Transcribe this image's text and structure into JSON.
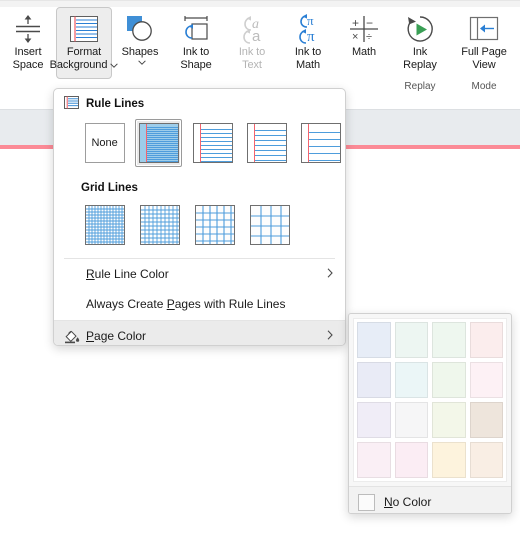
{
  "ribbon": {
    "groups": [
      {
        "label": "",
        "buttons": [
          {
            "name": "insert-space",
            "icon": "insert-space-icon",
            "line1": "Insert",
            "line2": "Space",
            "dim": false,
            "chevron": false,
            "active": false
          }
        ]
      },
      {
        "label": "",
        "buttons": [
          {
            "name": "format-background",
            "icon": "ruled-page-icon",
            "line1": "Format",
            "line2": "Background",
            "dim": false,
            "chevron": true,
            "active": true
          }
        ]
      },
      {
        "label": "",
        "buttons": [
          {
            "name": "shapes",
            "icon": "shapes-icon",
            "line1": "Shapes",
            "line2": "",
            "dim": false,
            "chevron": true,
            "active": false
          }
        ]
      },
      {
        "label": "",
        "buttons": [
          {
            "name": "ink-to-shape",
            "icon": "ink-to-shape-icon",
            "line1": "Ink to",
            "line2": "Shape",
            "dim": false,
            "chevron": false,
            "active": false
          },
          {
            "name": "ink-to-text",
            "icon": "ink-to-text-icon",
            "line1": "Ink to",
            "line2": "Text",
            "dim": true,
            "chevron": false,
            "active": false
          },
          {
            "name": "ink-to-math",
            "icon": "ink-to-math-icon",
            "line1": "Ink to",
            "line2": "Math",
            "dim": false,
            "chevron": false,
            "active": false
          },
          {
            "name": "math",
            "icon": "math-icon",
            "line1": "Math",
            "line2": "",
            "dim": false,
            "chevron": false,
            "active": false
          }
        ]
      },
      {
        "label": "Replay",
        "buttons": [
          {
            "name": "ink-replay",
            "icon": "ink-replay-icon",
            "line1": "Ink",
            "line2": "Replay",
            "dim": false,
            "chevron": false,
            "active": false
          }
        ]
      },
      {
        "label": "Mode",
        "buttons": [
          {
            "name": "full-page-view",
            "icon": "full-page-view-icon",
            "line1": "Full Page",
            "line2": "View",
            "dim": false,
            "chevron": false,
            "active": false
          }
        ]
      }
    ]
  },
  "menu": {
    "rule_lines": {
      "icon": "ruled-page-icon",
      "title": "Rule Lines",
      "thumbs": [
        {
          "name": "rule-lines-none",
          "label": "None",
          "kind": "none",
          "spacing": 0,
          "selected": false
        },
        {
          "name": "rule-lines-narrow",
          "label": "",
          "kind": "ruled",
          "spacing": 2,
          "selected": true
        },
        {
          "name": "rule-lines-college",
          "label": "",
          "kind": "ruled",
          "spacing": 4,
          "selected": false
        },
        {
          "name": "rule-lines-wide",
          "label": "",
          "kind": "ruled",
          "spacing": 5,
          "selected": false
        },
        {
          "name": "rule-lines-extra-wide",
          "label": "",
          "kind": "ruled",
          "spacing": 7,
          "selected": false
        }
      ]
    },
    "grid_lines": {
      "title": "Grid Lines",
      "thumbs": [
        {
          "name": "grid-lines-small",
          "label": "",
          "kind": "grid",
          "spacing": 3,
          "selected": false
        },
        {
          "name": "grid-lines-medium",
          "label": "",
          "kind": "grid",
          "spacing": 4,
          "selected": false
        },
        {
          "name": "grid-lines-large",
          "label": "",
          "kind": "grid",
          "spacing": 7,
          "selected": false
        },
        {
          "name": "grid-lines-very-large",
          "label": "",
          "kind": "grid",
          "spacing": 10,
          "selected": false
        }
      ]
    },
    "items": [
      {
        "name": "rule-line-color",
        "label_pre": "",
        "label_accel": "R",
        "label_post": "ule Line Color",
        "arrow": true,
        "icon": "",
        "highlight": false,
        "indent": true
      },
      {
        "name": "always-create-pages-with-rule-lines",
        "label_pre": "Always Create ",
        "label_accel": "P",
        "label_post": "ages with Rule Lines",
        "arrow": false,
        "icon": "",
        "highlight": false,
        "indent": true
      },
      {
        "name": "page-color",
        "label_pre": "",
        "label_accel": "P",
        "label_post": "age Color",
        "arrow": true,
        "icon": "paint-bucket-icon",
        "highlight": true,
        "indent": false
      }
    ]
  },
  "color_panel": {
    "swatches": [
      {
        "name": "swatch-blue-light",
        "color": "#e7edf7"
      },
      {
        "name": "swatch-teal-light",
        "color": "#edf6f2"
      },
      {
        "name": "swatch-green-light",
        "color": "#eef7ef"
      },
      {
        "name": "swatch-red-light",
        "color": "#fbeded"
      },
      {
        "name": "swatch-periwinkle",
        "color": "#e9ebf6"
      },
      {
        "name": "swatch-cyan-pale",
        "color": "#ebf6f7"
      },
      {
        "name": "swatch-mint-pale",
        "color": "#eff7ec"
      },
      {
        "name": "swatch-pink-pale",
        "color": "#fdf1f5"
      },
      {
        "name": "swatch-lavender",
        "color": "#f0edf7"
      },
      {
        "name": "swatch-grey-pale",
        "color": "#f6f6f7"
      },
      {
        "name": "swatch-lime-pale",
        "color": "#f3f7e9"
      },
      {
        "name": "swatch-tan",
        "color": "#eee5dc"
      },
      {
        "name": "swatch-rose-pale",
        "color": "#faeff5"
      },
      {
        "name": "swatch-magenta-pale",
        "color": "#fbedf4"
      },
      {
        "name": "swatch-cream",
        "color": "#fdf3dd"
      },
      {
        "name": "swatch-peach",
        "color": "#f9eee4"
      }
    ],
    "no_color": {
      "name": "no-color",
      "label_pre": "",
      "label_accel": "N",
      "label_post": "o Color"
    }
  }
}
